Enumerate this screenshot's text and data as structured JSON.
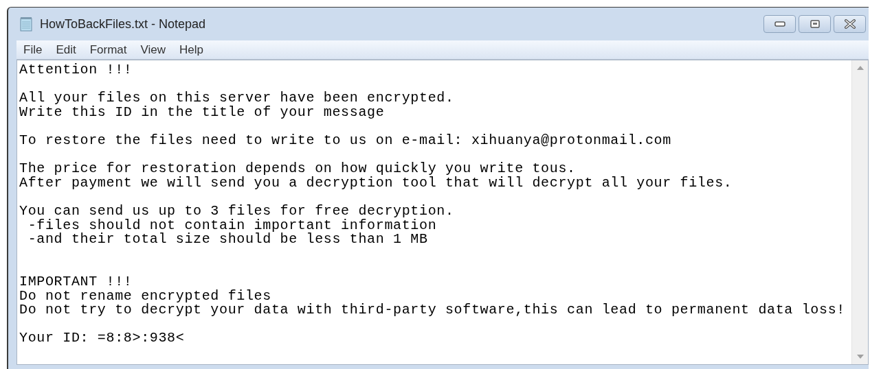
{
  "window": {
    "title": "HowToBackFiles.txt - Notepad",
    "controls": [
      {
        "kind": "minimize"
      },
      {
        "kind": "maximize"
      },
      {
        "kind": "close"
      }
    ]
  },
  "menu": [
    "File",
    "Edit",
    "Format",
    "View",
    "Help"
  ],
  "document": {
    "paragraphs": [
      {
        "lines": [
          "Attention !!!"
        ]
      },
      {
        "lines": [
          "All your files on this server have been encrypted.",
          "Write this ID in the title of your message"
        ]
      },
      {
        "lines": [
          "To restore the files need to write to us on e-mail: xihuanya@protonmail.com"
        ]
      },
      {
        "lines": [
          "The price for restoration depends on how quickly you write tous.",
          "After payment we will send you a decryption tool that will decrypt all your files."
        ]
      },
      {
        "lines": [
          "You can send us up to 3 files for free decryption.",
          " -files should not contain important information",
          " -and their total size should be less than 1 MB"
        ]
      },
      {
        "kind": "section",
        "lines": [
          "IMPORTANT !!!",
          "Do not rename encrypted files",
          "Do not try to decrypt your data with third-party software,this can lead to permanent data loss!"
        ]
      },
      {
        "lines": [
          "Your ID: =8:8>:938<"
        ]
      }
    ]
  }
}
